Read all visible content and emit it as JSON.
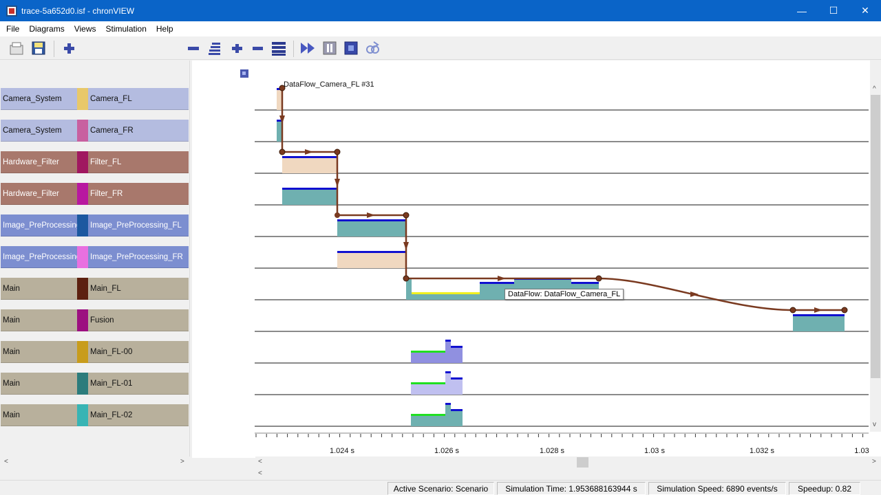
{
  "window": {
    "title": "trace-5a652d0.isf  -  chronVIEW",
    "minimize": "—",
    "maximize": "☐",
    "close": "✕"
  },
  "menu": [
    {
      "label": "File"
    },
    {
      "label": "Diagrams"
    },
    {
      "label": "Views"
    },
    {
      "label": "Stimulation"
    },
    {
      "label": "Help"
    }
  ],
  "toolbar": {
    "zoom_slider_value_fraction": 0.67
  },
  "rows": [
    {
      "group": "Camera_System",
      "name": "Camera_FL",
      "groupColor": "#b4bce0",
      "swatch": "#e8c86a"
    },
    {
      "group": "Camera_System",
      "name": "Camera_FR",
      "groupColor": "#b4bce0",
      "swatch": "#c860a0"
    },
    {
      "group": "Hardware_Filter",
      "name": "Filter_FL",
      "groupColor": "#a8786c",
      "swatch": "#a01860",
      "light": true
    },
    {
      "group": "Hardware_Filter",
      "name": "Filter_FR",
      "groupColor": "#a8786c",
      "swatch": "#b818a0",
      "light": true
    },
    {
      "group": "Image_PreProcessing",
      "name": "Image_PreProcessing_FL",
      "groupColor": "#7c8ed0",
      "swatch": "#1c58a0",
      "light": true
    },
    {
      "group": "Image_PreProcessing",
      "name": "Image_PreProcessing_FR",
      "groupColor": "#7c8ed0",
      "swatch": "#e870e0",
      "light": true
    },
    {
      "group": "Main",
      "name": "Main_FL",
      "groupColor": "#b8b09c",
      "swatch": "#5c2010"
    },
    {
      "group": "Main",
      "name": "Fusion",
      "groupColor": "#b8b09c",
      "swatch": "#9c1080"
    },
    {
      "group": "Main",
      "name": "Main_FL-00",
      "groupColor": "#b8b09c",
      "swatch": "#c89c1c"
    },
    {
      "group": "Main",
      "name": "Main_FL-01",
      "groupColor": "#b8b09c",
      "swatch": "#2c7c7c"
    },
    {
      "group": "Main",
      "name": "Main_FL-02",
      "groupColor": "#b8b09c",
      "swatch": "#38b4b4"
    }
  ],
  "chart_data": {
    "type": "gantt",
    "xunit": "s",
    "tick_labels": [
      "1.024 s",
      "1.026 s",
      "1.028 s",
      "1.03 s",
      "1.032 s",
      "1.03"
    ],
    "flow_label": "DataFlow_Camera_FL #31",
    "tooltip": "DataFlow: DataFlow_Camera_FL",
    "colors": {
      "flow": "#7a3a20",
      "bar_teal": "#6fb0b0",
      "bar_peach": "#f0d8c0",
      "bar_purple": "#9090e0",
      "bar_lavender": "#c0c0f0",
      "marker_blue": "#1010d0",
      "marker_green": "#20e020",
      "marker_yellow": "#f0f020"
    }
  },
  "status": {
    "scenario": "Active Scenario: Scenario",
    "sim_time": "Simulation Time: 1.953688163944 s",
    "sim_speed": "Simulation Speed: 6890 events/s",
    "speedup": "Speedup: 0.82"
  }
}
